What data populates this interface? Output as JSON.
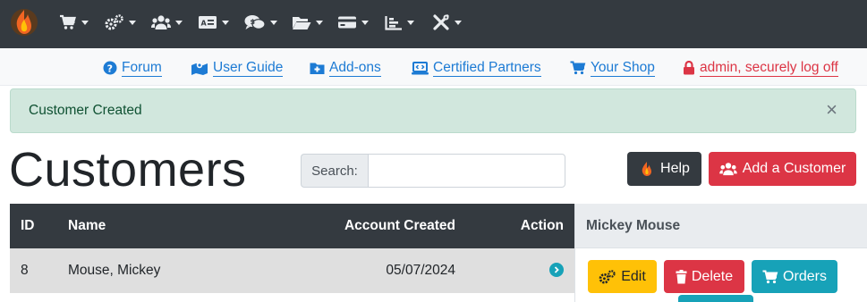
{
  "nav": {
    "menus": [
      {
        "icon": "cart-icon"
      },
      {
        "icon": "gears-icon"
      },
      {
        "icon": "users-icon"
      },
      {
        "icon": "id-card-icon"
      },
      {
        "icon": "comments-dollar-icon"
      },
      {
        "icon": "folder-open-icon"
      },
      {
        "icon": "credit-card-icon"
      },
      {
        "icon": "chart-bar-icon"
      },
      {
        "icon": "tools-icon"
      }
    ]
  },
  "toplinks": {
    "forum": "Forum",
    "user_guide": "User Guide",
    "addons": "Add-ons",
    "partners": "Certified Partners",
    "shop": "Your Shop",
    "logout": "admin, securely log off"
  },
  "alert": {
    "message": "Customer Created",
    "close": "×"
  },
  "page": {
    "title": "Customers"
  },
  "search": {
    "label": "Search:",
    "value": "",
    "placeholder": ""
  },
  "buttons": {
    "help": "Help",
    "add_customer": "Add a Customer"
  },
  "table": {
    "headers": {
      "id": "ID",
      "name": "Name",
      "created": "Account Created",
      "action": "Action"
    },
    "rows": [
      {
        "id": "8",
        "name": "Mouse, Mickey",
        "created": "05/07/2024"
      }
    ]
  },
  "panel": {
    "title": "Mickey Mouse",
    "edit": "Edit",
    "delete": "Delete",
    "orders": "Orders"
  },
  "colors": {
    "navbar": "#343a40",
    "link": "#1d7bd4",
    "danger": "#dc3545",
    "warning": "#ffc107",
    "info": "#17a2b8",
    "success_bg": "#d1e7dd"
  }
}
